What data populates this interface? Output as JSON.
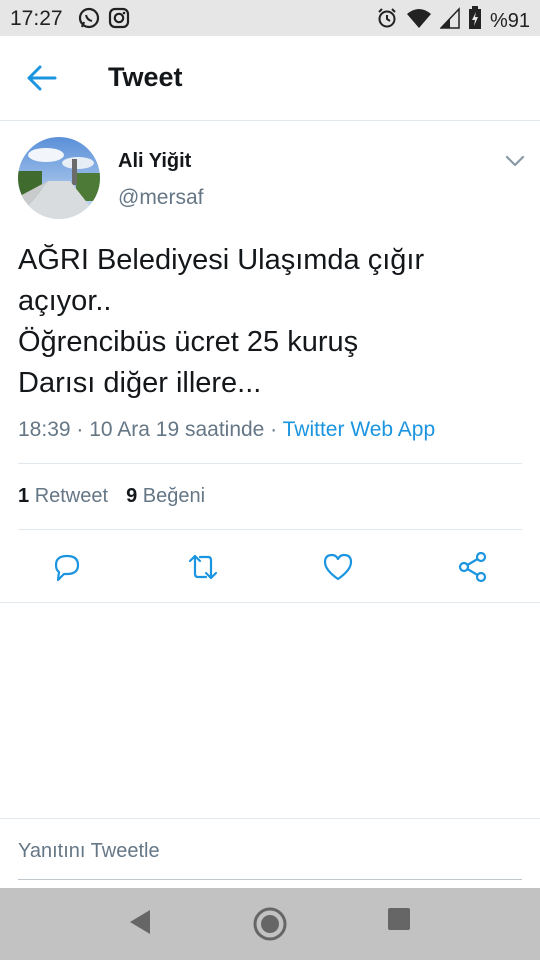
{
  "status_bar": {
    "time": "17:27",
    "battery": "%91",
    "icons": [
      "whatsapp-icon",
      "instagram-icon",
      "alarm-icon",
      "wifi-icon",
      "signal-icon",
      "battery-icon"
    ]
  },
  "header": {
    "title": "Tweet",
    "back_icon": "arrow-left-icon"
  },
  "tweet": {
    "author_name": "Ali Yiğit",
    "author_handle": "@mersaf",
    "text_lines": [
      "AĞRI Belediyesi Ulaşımda çığır",
      "açıyor..",
      "Öğrencibüs ücret 25 kuruş",
      "Darısı diğer illere..."
    ],
    "timestamp": "18:39 · 10 Ara 19 saatinde · ",
    "source": "Twitter Web App",
    "retweet_count": "1",
    "retweet_label": "Retweet",
    "like_count": "9",
    "like_label": "Beğeni"
  },
  "actions": [
    "reply-icon",
    "retweet-icon",
    "like-icon",
    "share-icon"
  ],
  "reply": {
    "placeholder": "Yanıtını Tweetle"
  },
  "colors": {
    "accent": "#1b95e0",
    "secondary_text": "#657786",
    "divider": "#e1e8ed",
    "status_bar": "#e6e6e6",
    "nav_bar": "#c2c2c2"
  }
}
